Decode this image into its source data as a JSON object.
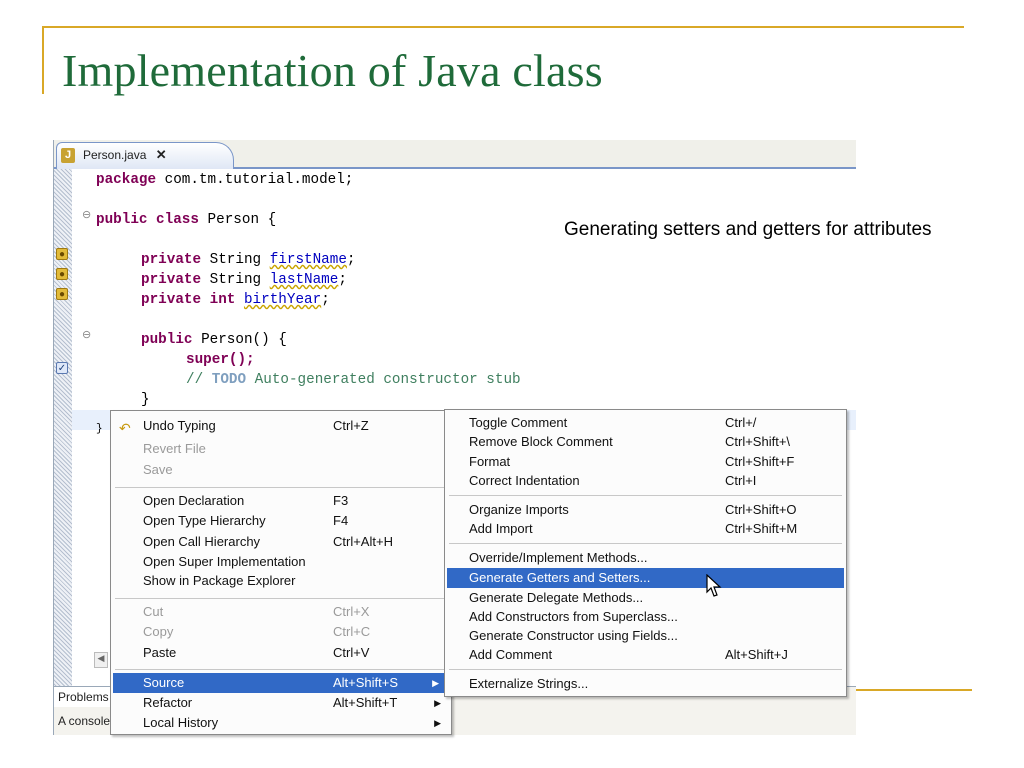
{
  "slide": {
    "title": "Implementation of Java class",
    "note": "Generating setters and getters for attributes",
    "accent_color": "#d9a827",
    "title_color": "#1f6b3a"
  },
  "editor": {
    "tab_label": "Person.java",
    "tab_close": "✕",
    "tab_icon": "java-file-icon",
    "code_lines": {
      "l1": "package com.tm.tutorial.model;",
      "l2_kw": "public class",
      "l2_rest": " Person {",
      "l3_kw": "private",
      "l3_type": " String ",
      "l3_field": "firstName",
      "l4_kw": "private",
      "l4_type": " String ",
      "l4_field": "lastName",
      "l5_kw": "private int",
      "l5_field": "birthYear",
      "l6_kw": "public",
      "l6_rest": " Person() {",
      "l7": "super();",
      "l8_comment": "// ",
      "l8_todo": "TODO",
      "l8_rest": " Auto-generated constructor stub",
      "l9": "}",
      "l10": "}"
    }
  },
  "problems": {
    "tab_label": "Problems",
    "line": "A console"
  },
  "context_menu": {
    "items": [
      {
        "label": "Undo Typing",
        "shortcut": "Ctrl+Z"
      },
      {
        "label": "Revert File",
        "shortcut": ""
      },
      {
        "label": "Save",
        "shortcut": ""
      },
      {
        "label": "Open Declaration",
        "shortcut": "F3"
      },
      {
        "label": "Open Type Hierarchy",
        "shortcut": "F4"
      },
      {
        "label": "Open Call Hierarchy",
        "shortcut": "Ctrl+Alt+H"
      },
      {
        "label": "Open Super Implementation",
        "shortcut": ""
      },
      {
        "label": "Show in Package Explorer",
        "shortcut": ""
      },
      {
        "label": "Cut",
        "shortcut": "Ctrl+X"
      },
      {
        "label": "Copy",
        "shortcut": "Ctrl+C"
      },
      {
        "label": "Paste",
        "shortcut": "Ctrl+V"
      },
      {
        "label": "Source",
        "shortcut": "Alt+Shift+S"
      },
      {
        "label": "Refactor",
        "shortcut": "Alt+Shift+T"
      },
      {
        "label": "Local History",
        "shortcut": ""
      }
    ],
    "highlight_color": "#3169c6"
  },
  "source_submenu": {
    "items": [
      {
        "label": "Toggle Comment",
        "shortcut": "Ctrl+/"
      },
      {
        "label": "Remove Block Comment",
        "shortcut": "Ctrl+Shift+\\"
      },
      {
        "label": "Format",
        "shortcut": "Ctrl+Shift+F"
      },
      {
        "label": "Correct Indentation",
        "shortcut": "Ctrl+I"
      },
      {
        "label": "Organize Imports",
        "shortcut": "Ctrl+Shift+O"
      },
      {
        "label": "Add Import",
        "shortcut": "Ctrl+Shift+M"
      },
      {
        "label": "Override/Implement Methods...",
        "shortcut": ""
      },
      {
        "label": "Generate Getters and Setters...",
        "shortcut": ""
      },
      {
        "label": "Generate Delegate Methods...",
        "shortcut": ""
      },
      {
        "label": "Add Constructors from Superclass...",
        "shortcut": ""
      },
      {
        "label": "Generate Constructor using Fields...",
        "shortcut": ""
      },
      {
        "label": "Add Comment",
        "shortcut": "Alt+Shift+J"
      },
      {
        "label": "Externalize Strings...",
        "shortcut": ""
      }
    ]
  }
}
